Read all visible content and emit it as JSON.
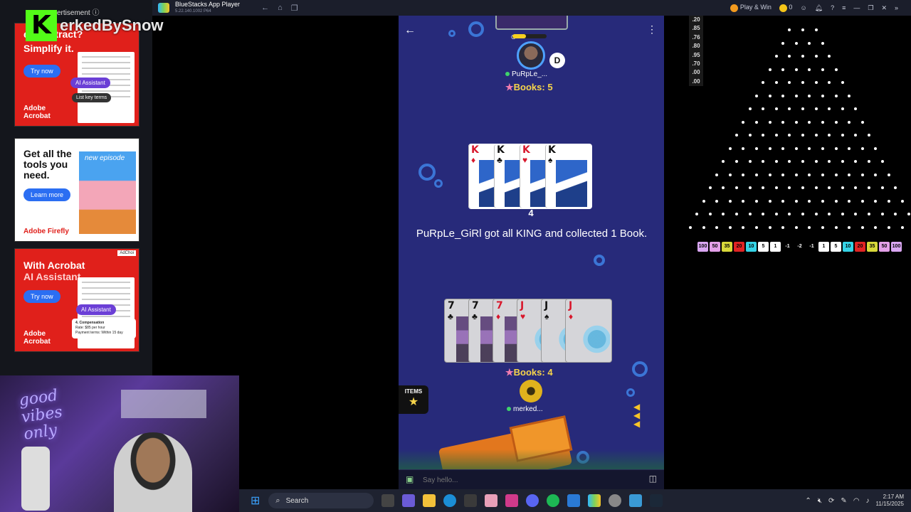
{
  "ad_column": {
    "label": "ertisement ⓘ",
    "ad1": {
      "headline_top": "ex contract?",
      "headline": "Simplify it.",
      "cta": "Try now",
      "ai_pill": "AI Assistant",
      "key_terms": "List key terms",
      "brand": "Adobe\nAcrobat"
    },
    "ad2": {
      "headline": "Get all the tools you need.",
      "cta": "Learn more",
      "sticker": "new episode",
      "brand": "Adobe Firefly"
    },
    "ad3": {
      "headline": "With Acrobat",
      "headline2": "AI Assistant.",
      "cta": "Try now",
      "ai_pill": "AI Assistant",
      "card_title": "4. Compensation",
      "card_line1": "Rate: $85 per hour",
      "card_line2": "Payment terms: Within 15 day",
      "brand": "Adobe\nAcrobat",
      "adchoices": "AdChoi"
    }
  },
  "stream_overlay": {
    "logo": "K",
    "name": "erkedBySnow"
  },
  "webcam": {
    "neon_text": "good\nvibes\nonly"
  },
  "bluestacks": {
    "title": "BlueStacks App Player",
    "version": "5.22.140.1002  P64",
    "play_win": "Play & Win",
    "coins": "0"
  },
  "game": {
    "opponent": {
      "badge": "D",
      "name": "PuRpLe_...",
      "books_label": "Books: 5"
    },
    "center_cards": [
      {
        "rank": "K",
        "suit": "♦",
        "color": "red"
      },
      {
        "rank": "K",
        "suit": "♣",
        "color": "blk"
      },
      {
        "rank": "K",
        "suit": "♥",
        "color": "red"
      },
      {
        "rank": "K",
        "suit": "♠",
        "color": "blk"
      }
    ],
    "book_count": "4",
    "message": "PuRpLe_GiRl got all KING and collected 1 Book.",
    "hand": [
      {
        "rank": "7",
        "suit": "♣",
        "color": "blk"
      },
      {
        "rank": "7",
        "suit": "♣",
        "color": "blk"
      },
      {
        "rank": "7",
        "suit": "♦",
        "color": "red"
      },
      {
        "rank": "J",
        "suit": "♥",
        "color": "red"
      },
      {
        "rank": "J",
        "suit": "♠",
        "color": "blk"
      },
      {
        "rank": "J",
        "suit": "♦",
        "color": "red"
      }
    ],
    "player": {
      "name": "merked...",
      "books_label": "Books: 4"
    },
    "items_label": "ITEMS",
    "chat_placeholder": "Say hello..."
  },
  "plinko": {
    "multipliers": [
      ".20",
      ".85",
      ".76",
      ".80",
      ".95",
      ".70",
      ".00",
      ".00"
    ],
    "slots": [
      {
        "label": "100",
        "color": "#d9a6f2"
      },
      {
        "label": "50",
        "color": "#e3a0e8"
      },
      {
        "label": "35",
        "color": "#d8d83a"
      },
      {
        "label": "20",
        "color": "#e02424"
      },
      {
        "label": "10",
        "color": "#35d3e6"
      },
      {
        "label": "5",
        "color": "#ffffff"
      },
      {
        "label": "1",
        "color": "#ffffff"
      },
      {
        "label": "-1",
        "color": "#000000"
      },
      {
        "label": "-2",
        "color": "#000000"
      },
      {
        "label": "-1",
        "color": "#000000"
      },
      {
        "label": "1",
        "color": "#ffffff"
      },
      {
        "label": "5",
        "color": "#ffffff"
      },
      {
        "label": "10",
        "color": "#35d3e6"
      },
      {
        "label": "20",
        "color": "#e02424"
      },
      {
        "label": "35",
        "color": "#d8d83a"
      },
      {
        "label": "50",
        "color": "#e3a0e8"
      },
      {
        "label": "100",
        "color": "#d9a6f2"
      }
    ]
  },
  "taskbar": {
    "search": "Search",
    "time": "2:17 AM",
    "date": "11/15/2025"
  }
}
